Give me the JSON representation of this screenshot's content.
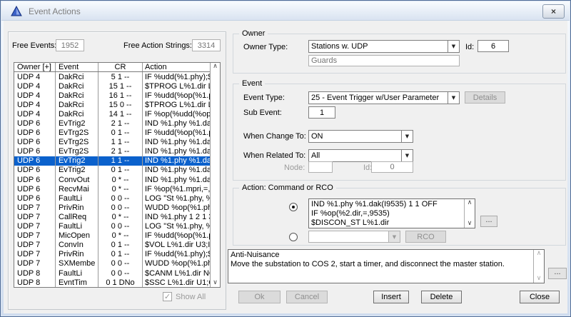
{
  "window": {
    "title": "Event Actions"
  },
  "icons": {
    "close": "×",
    "dropdown": "▼",
    "scroll_up": "∧",
    "scroll_down": "∨",
    "check": "✓",
    "ellipsis": "..."
  },
  "colors": {
    "selection_blue": "#0b61cc",
    "frame_blue": "#4e6b96",
    "dialog_bg": "#f0f0f0"
  },
  "left_panel": {
    "free_events_label": "Free Events:",
    "free_events_value": "1952",
    "free_action_strings_label": "Free Action Strings:",
    "free_action_strings_value": "3314",
    "show_all_label": "Show All",
    "table": {
      "columns": [
        "Owner [+]",
        "Event",
        "CR",
        "Action"
      ],
      "selected_index": 9,
      "rows": [
        [
          "UDP 4",
          "DakRci",
          "5 1 --",
          "IF %udd(%1.phy);$"
        ],
        [
          "UDP 4",
          "DakRci",
          "15 1 --",
          "$TPROG L%1.dir L"
        ],
        [
          "UDP 4",
          "DakRci",
          "16 1 --",
          "IF %udd(%op(%1.pl"
        ],
        [
          "UDP 4",
          "DakRci",
          "15 0 --",
          "$TPROG L%1.dir L"
        ],
        [
          "UDP 4",
          "DakRci",
          "14 1 --",
          "IF %op(%udd(%op("
        ],
        [
          "UDP 6",
          "EvTrig2",
          "2 1 --",
          "IND %1.phy %1.da"
        ],
        [
          "UDP 6",
          "EvTrg2S",
          "0 1 --",
          "IF %udd(%op(%1.pl"
        ],
        [
          "UDP 6",
          "EvTrg2S",
          "1 1 --",
          "IND %1.phy %1.da"
        ],
        [
          "UDP 6",
          "EvTrg2S",
          "2 1 --",
          "IND %1.phy %1.da"
        ],
        [
          "UDP 6",
          "EvTrig2",
          "1 1 --",
          "IND %1.phy %1.da"
        ],
        [
          "UDP 6",
          "EvTrig2",
          "0 1 --",
          "IND %1.phy %1.da"
        ],
        [
          "UDP 6",
          "ConvOut",
          "0 * --",
          "IND %1.phy %1.da"
        ],
        [
          "UDP 6",
          "RecvMai",
          "0 * --",
          "IF %op(%1.mpri,=,4"
        ],
        [
          "UDP 6",
          "FaultLi",
          "0 0 --",
          "LOG \"St %1.phy, %"
        ],
        [
          "UDP 7",
          "PrivRin",
          "0 0 --",
          "WUDD %op(%1.ph"
        ],
        [
          "UDP 7",
          "CallReq",
          "0 * --",
          "IND %1.phy 1 2 1 3"
        ],
        [
          "UDP 7",
          "FaultLi",
          "0 0 --",
          "LOG \"St %1.phy, %"
        ],
        [
          "UDP 7",
          "MicOpen",
          "0 * --",
          "IF %udd(%op(%1.pl"
        ],
        [
          "UDP 7",
          "ConvIn",
          "0 1 --",
          "$VOL L%1.dir U3;II"
        ],
        [
          "UDP 7",
          "PrivRin",
          "0 1 --",
          "IF %udd(%1.phy);$l"
        ],
        [
          "UDP 7",
          "SXMembe",
          "0 0 --",
          "WUDD %op(%1.ph"
        ],
        [
          "UDP 8",
          "FaultLi",
          "0 0 --",
          "$CANM L%1.dir NO"
        ],
        [
          "UDP 8",
          "EvntTim",
          "0 1 DNo",
          "$SSC L%1.dir U1;C"
        ]
      ]
    }
  },
  "owner_section": {
    "legend": "Owner",
    "owner_type_label": "Owner Type:",
    "owner_type_value": "Stations w. UDP",
    "id_label": "Id:",
    "id_value": "6",
    "guards_value": "Guards"
  },
  "event_section": {
    "legend": "Event",
    "event_type_label": "Event Type:",
    "event_type_value": "25 - Event Trigger w/User Parameter",
    "details_label": "Details",
    "sub_event_label": "Sub Event:",
    "sub_event_value": "1",
    "when_change_label": "When Change To:",
    "when_change_value": "ON",
    "when_related_label": "When Related To:",
    "when_related_value": "All",
    "node_label": "Node:",
    "node_value": "",
    "node_id_label": "Id:",
    "node_id_value": "0"
  },
  "action_section": {
    "legend": "Action: Command or RCO",
    "command_text": "IND %1.phy %1.dak(I9535) 1 1 OFF\nIF %op(%2.dir,=,9535)\n$DISCON_ST L%1.dir",
    "rco_value": "",
    "rco_label": "RCO"
  },
  "anti_nuisance": {
    "text": "Anti-Nuisance\nMove the substation to COS 2, start a timer, and disconnect the master station."
  },
  "footer": {
    "ok": "Ok",
    "cancel": "Cancel",
    "insert": "Insert",
    "delete": "Delete",
    "close": "Close"
  }
}
